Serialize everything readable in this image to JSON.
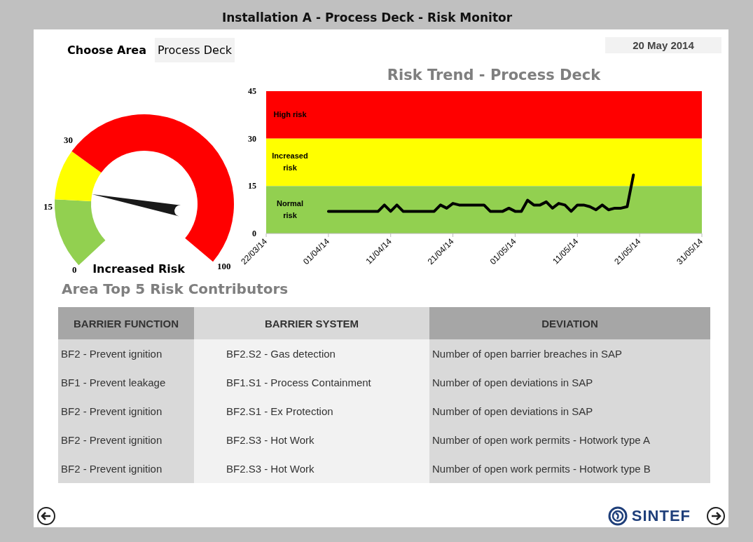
{
  "window": {
    "title": "Installation A - Process Deck - Risk Monitor"
  },
  "area": {
    "label": "Choose Area",
    "value": "Process Deck"
  },
  "date": "20 May 2014",
  "gauge": {
    "status": "Increased Risk",
    "ticks": [
      "0",
      "15",
      "30",
      "100"
    ]
  },
  "trend": {
    "chart_data": {
      "type": "line",
      "title": "Risk Trend - Process Deck",
      "categories": [
        "22/03/14",
        null,
        null,
        null,
        null,
        null,
        null,
        null,
        null,
        null,
        "01/04/14",
        null,
        null,
        null,
        null,
        null,
        null,
        null,
        null,
        null,
        "11/04/14",
        null,
        null,
        null,
        null,
        null,
        null,
        null,
        null,
        null,
        "21/04/14",
        null,
        null,
        null,
        null,
        null,
        null,
        null,
        null,
        null,
        "01/05/14",
        null,
        null,
        null,
        null,
        null,
        null,
        null,
        null,
        null,
        "11/05/14",
        null,
        null,
        null,
        null,
        null,
        null,
        null,
        null,
        null,
        "21/05/14",
        null,
        null,
        null,
        null,
        null,
        null,
        null,
        null,
        null,
        "31/05/14"
      ],
      "series": [
        {
          "color": "#000000",
          "values": [
            null,
            null,
            null,
            null,
            null,
            null,
            null,
            null,
            null,
            null,
            7,
            7,
            7,
            7,
            7,
            7,
            7,
            7,
            7,
            9,
            7,
            9,
            7,
            7,
            7,
            7,
            7,
            7,
            9,
            8,
            9.5,
            9,
            9,
            9,
            9,
            9,
            7,
            7,
            7,
            8,
            7,
            7,
            10.5,
            9,
            9,
            10,
            8,
            9.5,
            9,
            7,
            9,
            9,
            8.5,
            7.5,
            9,
            7.5,
            8,
            8,
            8.5,
            18.5,
            null,
            null,
            null,
            null,
            null,
            null,
            null,
            null,
            null,
            null,
            null
          ]
        }
      ],
      "ylim": [
        0,
        45
      ],
      "yticks": [
        0,
        15,
        30,
        45
      ],
      "bands": [
        {
          "axis": "y",
          "from": 30,
          "to": 45,
          "label": "High risk",
          "color": "#ff0000"
        },
        {
          "axis": "y",
          "from": 15,
          "to": 30,
          "label": "Increased risk",
          "color": "#ffff00"
        },
        {
          "axis": "y",
          "from": 0,
          "to": 15,
          "label": "Normal risk",
          "color": "#92d050"
        }
      ]
    }
  },
  "contributors": {
    "title": "Area Top 5 Risk Contributors",
    "columns": [
      "BARRIER FUNCTION",
      "BARRIER SYSTEM",
      "DEVIATION"
    ],
    "rows": [
      [
        "BF2 - Prevent ignition",
        "BF2.S2 - Gas detection",
        "Number of open barrier breaches in SAP"
      ],
      [
        "BF1 - Prevent leakage",
        "BF1.S1 - Process Containment",
        "Number of open deviations in SAP"
      ],
      [
        "BF2 - Prevent ignition",
        "BF2.S1 - Ex Protection",
        "Number of open deviations in SAP"
      ],
      [
        "BF2 - Prevent ignition",
        "BF2.S3 - Hot Work",
        "Number of open work permits - Hotwork type A"
      ],
      [
        "BF2 - Prevent ignition",
        "BF2.S3 - Hot Work",
        "Number of open work permits - Hotwork type B"
      ]
    ]
  },
  "logo": "SINTEF"
}
